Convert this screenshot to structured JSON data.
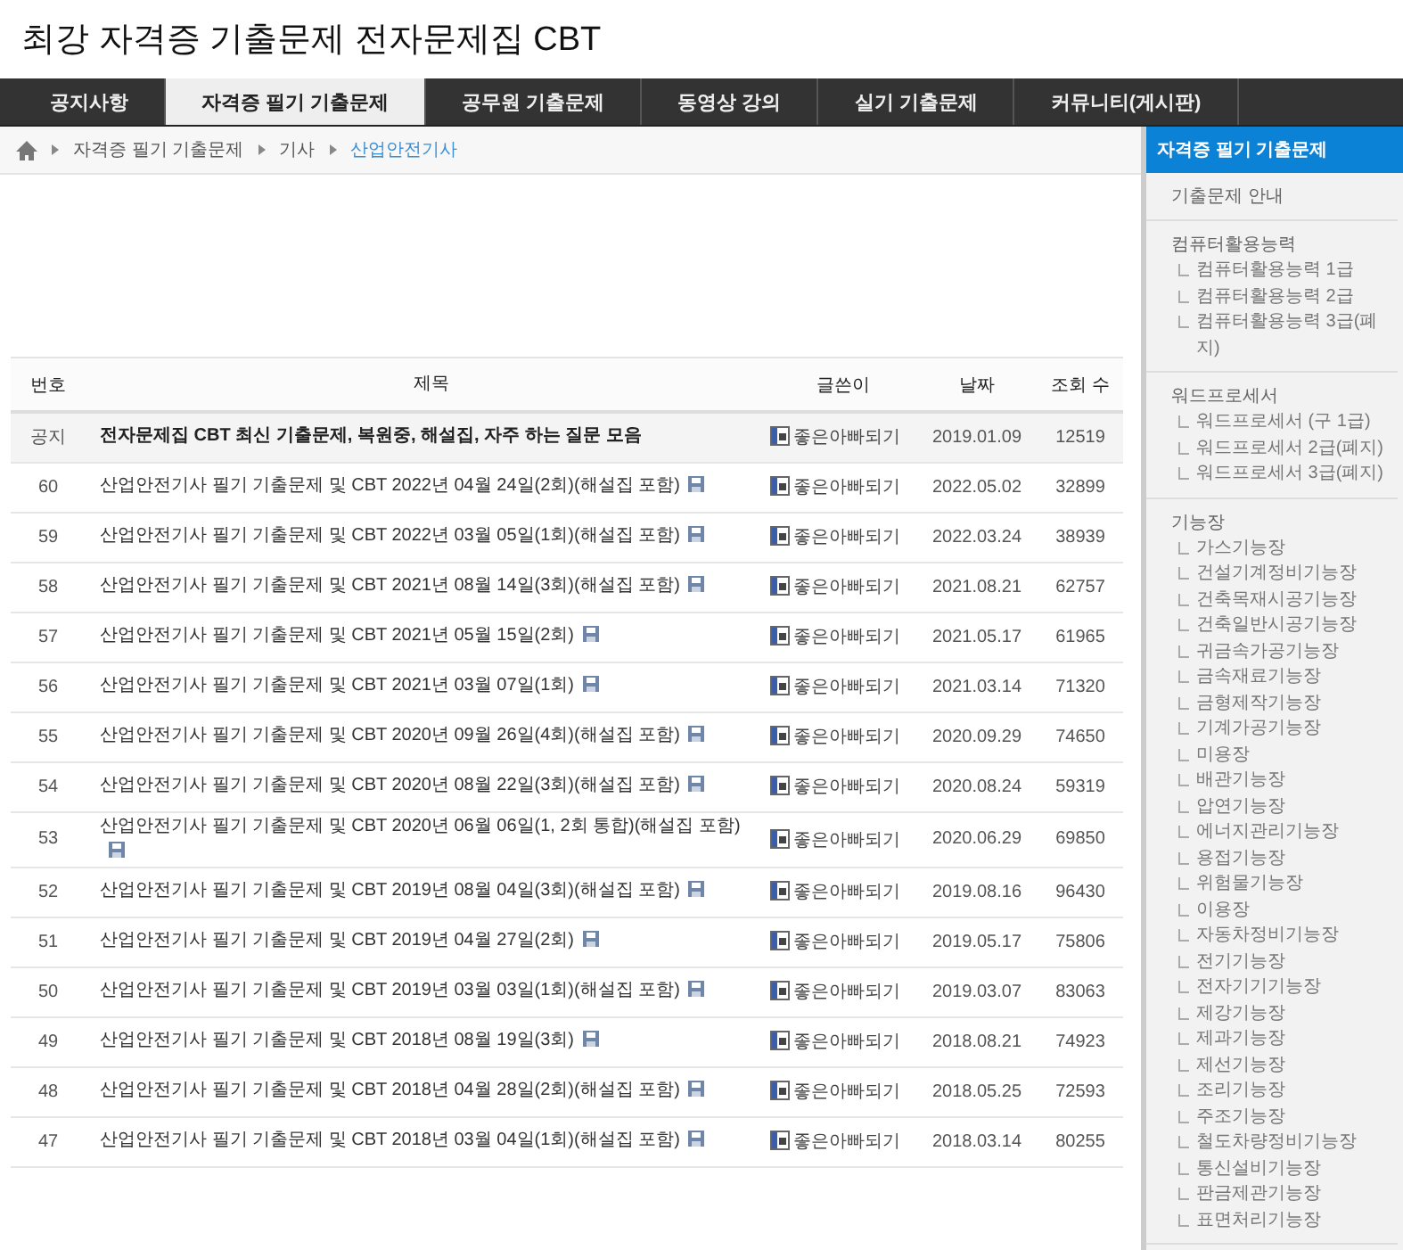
{
  "site_title": "최강 자격증 기출문제 전자문제집 CBT",
  "nav_tabs": [
    {
      "label": "공지사항",
      "selected": false
    },
    {
      "label": "자격증 필기 기출문제",
      "selected": true
    },
    {
      "label": "공무원 기출문제",
      "selected": false
    },
    {
      "label": "동영상 강의",
      "selected": false
    },
    {
      "label": "실기 기출문제",
      "selected": false
    },
    {
      "label": "커뮤니티(게시판)",
      "selected": false
    }
  ],
  "breadcrumb": [
    {
      "label": "자격증 필기 기출문제",
      "current": false
    },
    {
      "label": "기사",
      "current": false
    },
    {
      "label": "산업안전기사",
      "current": true
    }
  ],
  "table": {
    "columns": [
      "번호",
      "제목",
      "글쓴이",
      "날짜",
      "조회 수"
    ],
    "rows": [
      {
        "kind": "notice",
        "number": "공지",
        "title": "전자문제집 CBT 최신 기출문제, 복원중, 해설집, 자주 하는 질문 모음",
        "attachment": false,
        "writer": "좋은아빠되기",
        "date": "2019.01.09",
        "views": "12519"
      },
      {
        "kind": "post",
        "number": "60",
        "title": "산업안전기사 필기 기출문제 및 CBT 2022년 04월 24일(2회)(해설집 포함)",
        "attachment": true,
        "writer": "좋은아빠되기",
        "date": "2022.05.02",
        "views": "32899"
      },
      {
        "kind": "post",
        "number": "59",
        "title": "산업안전기사 필기 기출문제 및 CBT 2022년 03월 05일(1회)(해설집 포함)",
        "attachment": true,
        "writer": "좋은아빠되기",
        "date": "2022.03.24",
        "views": "38939"
      },
      {
        "kind": "post",
        "number": "58",
        "title": "산업안전기사 필기 기출문제 및 CBT 2021년 08월 14일(3회)(해설집 포함)",
        "attachment": true,
        "writer": "좋은아빠되기",
        "date": "2021.08.21",
        "views": "62757"
      },
      {
        "kind": "post",
        "number": "57",
        "title": "산업안전기사 필기 기출문제 및 CBT 2021년 05월 15일(2회)",
        "attachment": true,
        "writer": "좋은아빠되기",
        "date": "2021.05.17",
        "views": "61965"
      },
      {
        "kind": "post",
        "number": "56",
        "title": "산업안전기사 필기 기출문제 및 CBT 2021년 03월 07일(1회)",
        "attachment": true,
        "writer": "좋은아빠되기",
        "date": "2021.03.14",
        "views": "71320"
      },
      {
        "kind": "post",
        "number": "55",
        "title": "산업안전기사 필기 기출문제 및 CBT 2020년 09월 26일(4회)(해설집 포함)",
        "attachment": true,
        "writer": "좋은아빠되기",
        "date": "2020.09.29",
        "views": "74650"
      },
      {
        "kind": "post",
        "number": "54",
        "title": "산업안전기사 필기 기출문제 및 CBT 2020년 08월 22일(3회)(해설집 포함)",
        "attachment": true,
        "writer": "좋은아빠되기",
        "date": "2020.08.24",
        "views": "59319"
      },
      {
        "kind": "post",
        "number": "53",
        "title": "산업안전기사 필기 기출문제 및 CBT 2020년 06월 06일(1, 2회 통합)(해설집 포함)",
        "attachment": true,
        "writer": "좋은아빠되기",
        "date": "2020.06.29",
        "views": "69850"
      },
      {
        "kind": "post",
        "number": "52",
        "title": "산업안전기사 필기 기출문제 및 CBT 2019년 08월 04일(3회)(해설집 포함)",
        "attachment": true,
        "writer": "좋은아빠되기",
        "date": "2019.08.16",
        "views": "96430"
      },
      {
        "kind": "post",
        "number": "51",
        "title": "산업안전기사 필기 기출문제 및 CBT 2019년 04월 27일(2회)",
        "attachment": true,
        "writer": "좋은아빠되기",
        "date": "2019.05.17",
        "views": "75806"
      },
      {
        "kind": "post",
        "number": "50",
        "title": "산업안전기사 필기 기출문제 및 CBT 2019년 03월 03일(1회)(해설집 포함)",
        "attachment": true,
        "writer": "좋은아빠되기",
        "date": "2019.03.07",
        "views": "83063"
      },
      {
        "kind": "post",
        "number": "49",
        "title": "산업안전기사 필기 기출문제 및 CBT 2018년 08월 19일(3회)",
        "attachment": true,
        "writer": "좋은아빠되기",
        "date": "2018.08.21",
        "views": "74923"
      },
      {
        "kind": "post",
        "number": "48",
        "title": "산업안전기사 필기 기출문제 및 CBT 2018년 04월 28일(2회)(해설집 포함)",
        "attachment": true,
        "writer": "좋은아빠되기",
        "date": "2018.05.25",
        "views": "72593"
      },
      {
        "kind": "post",
        "number": "47",
        "title": "산업안전기사 필기 기출문제 및 CBT 2018년 03월 04일(1회)(해설집 포함)",
        "attachment": true,
        "writer": "좋은아빠되기",
        "date": "2018.03.14",
        "views": "80255"
      }
    ]
  },
  "sidebar": {
    "title": "자격증 필기 기출문제",
    "groups": [
      {
        "label": "기출문제 안내"
      },
      {
        "label": "컴퓨터활용능력",
        "children": [
          {
            "label": "컴퓨터활용능력 1급"
          },
          {
            "label": "컴퓨터활용능력 2급"
          },
          {
            "label": "컴퓨터활용능력 3급(폐지)"
          }
        ]
      },
      {
        "label": "워드프로세서",
        "children": [
          {
            "label": "워드프로세서 (구 1급)"
          },
          {
            "label": "워드프로세서 2급(폐지)"
          },
          {
            "label": "워드프로세서 3급(폐지)"
          }
        ]
      },
      {
        "label": "기능장",
        "children": [
          {
            "label": "가스기능장"
          },
          {
            "label": "건설기계정비기능장"
          },
          {
            "label": "건축목재시공기능장"
          },
          {
            "label": "건축일반시공기능장"
          },
          {
            "label": "귀금속가공기능장"
          },
          {
            "label": "금속재료기능장"
          },
          {
            "label": "금형제작기능장"
          },
          {
            "label": "기계가공기능장"
          },
          {
            "label": "미용장"
          },
          {
            "label": "배관기능장"
          },
          {
            "label": "압연기능장"
          },
          {
            "label": "에너지관리기능장"
          },
          {
            "label": "용접기능장"
          },
          {
            "label": "위험물기능장"
          },
          {
            "label": "이용장"
          },
          {
            "label": "자동차정비기능장"
          },
          {
            "label": "전기기능장"
          },
          {
            "label": "전자기기기능장"
          },
          {
            "label": "제강기능장"
          },
          {
            "label": "제과기능장"
          },
          {
            "label": "제선기능장"
          },
          {
            "label": "조리기능장"
          },
          {
            "label": "주조기능장"
          },
          {
            "label": "철도차량정비기능장"
          },
          {
            "label": "통신설비기능장"
          },
          {
            "label": "판금제관기능장"
          },
          {
            "label": "표면처리기능장"
          }
        ]
      }
    ]
  }
}
